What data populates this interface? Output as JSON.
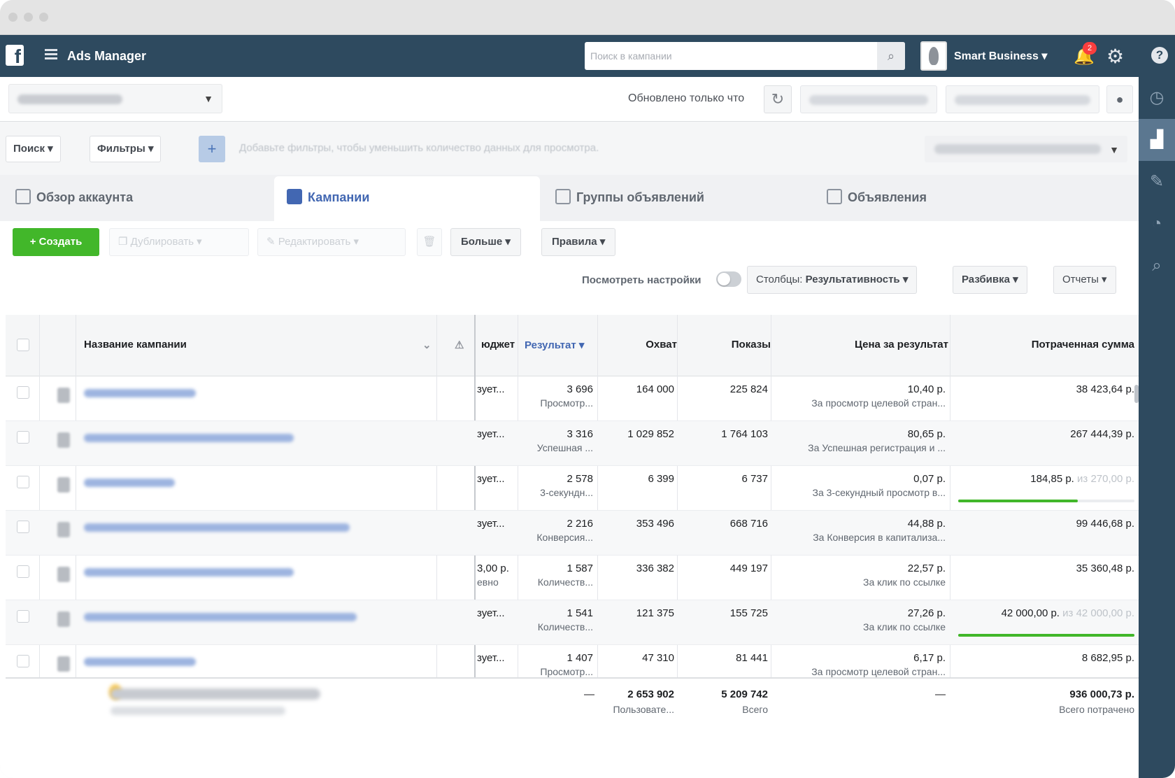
{
  "topbar": {
    "app_title": "Ads Manager",
    "search_placeholder": "Поиск в кампании",
    "account_name": "Smart Business ▾",
    "notification_count": "2"
  },
  "accountbar": {
    "updated_text": "Обновлено только что"
  },
  "filterbar": {
    "search_label": "Поиск ▾",
    "filters_label": "Фильтры ▾",
    "hint": "Добавьте фильтры, чтобы уменьшить количество данных для просмотра."
  },
  "tabs": [
    {
      "label": "Обзор аккаунта"
    },
    {
      "label": "Кампании"
    },
    {
      "label": "Группы объявлений"
    },
    {
      "label": "Объявления"
    }
  ],
  "toolbar": {
    "create_label": "+ Создать",
    "duplicate_label": "Дублировать",
    "edit_label": "Редактировать",
    "more_label": "Больше ▾",
    "rules_label": "Правила ▾",
    "view_settings_label": "Посмотреть настройки",
    "columns_prefix": "Столбцы:",
    "columns_value": "Результативность ▾",
    "breakdown_label": "Разбивка ▾",
    "reports_label": "Отчеты ▾"
  },
  "table": {
    "headers": {
      "name": "Название кампании",
      "budget": "юджет",
      "result": "Результат ▾",
      "reach": "Охват",
      "impressions": "Показы",
      "cost": "Цена за результат",
      "spent": "Потраченная сумма"
    },
    "rows": [
      {
        "budget": "зует...",
        "result": "3 696",
        "result_type": "Просмотр...",
        "reach": "164 000",
        "impressions": "225 824",
        "cost": "10,40 р.",
        "cost_type": "За просмотр целевой стран...",
        "spent": "38 423,64 р.",
        "budget_progress": null
      },
      {
        "budget": "зует...",
        "result": "3 316",
        "result_type": "Успешная ...",
        "reach": "1 029 852",
        "impressions": "1 764 103",
        "cost": "80,65 р.",
        "cost_type": "За Успешная регистрация и ...",
        "spent": "267 444,39 р.",
        "budget_progress": null
      },
      {
        "budget": "зует...",
        "result": "2 578",
        "result_type": "3-секундн...",
        "reach": "6 399",
        "impressions": "6 737",
        "cost": "0,07 р.",
        "cost_type": "За 3-секундный просмотр в...",
        "spent": "184,85 р.",
        "spent_note": "из 270,00 р.",
        "budget_progress": 0.68
      },
      {
        "budget": "зует...",
        "result": "2 216",
        "result_type": "Конверсия...",
        "reach": "353 496",
        "impressions": "668 716",
        "cost": "44,88 р.",
        "cost_type": "За Конверсия в капитализа...",
        "spent": "99 446,68 р.",
        "budget_progress": null
      },
      {
        "budget": "3,00 р.",
        "budget_note": "евно",
        "result": "1 587",
        "result_type": "Количеств...",
        "reach": "336 382",
        "impressions": "449 197",
        "cost": "22,57 р.",
        "cost_type": "За клик по ссылке",
        "spent": "35 360,48 р.",
        "budget_progress": null
      },
      {
        "budget": "зует...",
        "result": "1 541",
        "result_type": "Количеств...",
        "reach": "121 375",
        "impressions": "155 725",
        "cost": "27,26 р.",
        "cost_type": "За клик по ссылке",
        "spent": "42 000,00 р.",
        "spent_note": "из 42 000,00 р.",
        "budget_progress": 1.0
      },
      {
        "budget": "зует...",
        "result": "1 407",
        "result_type": "Просмотр...",
        "reach": "47 310",
        "impressions": "81 441",
        "cost": "6,17 р.",
        "cost_type": "За просмотр целевой стран...",
        "spent": "8 682,95 р.",
        "budget_progress": null
      }
    ],
    "totals": {
      "result": "—",
      "reach": "2 653 902",
      "reach_note": "Пользовате...",
      "impressions": "5 209 742",
      "impressions_note": "Всего",
      "cost": "—",
      "spent": "936 000,73 р.",
      "spent_note": "Всего потрачено"
    }
  }
}
